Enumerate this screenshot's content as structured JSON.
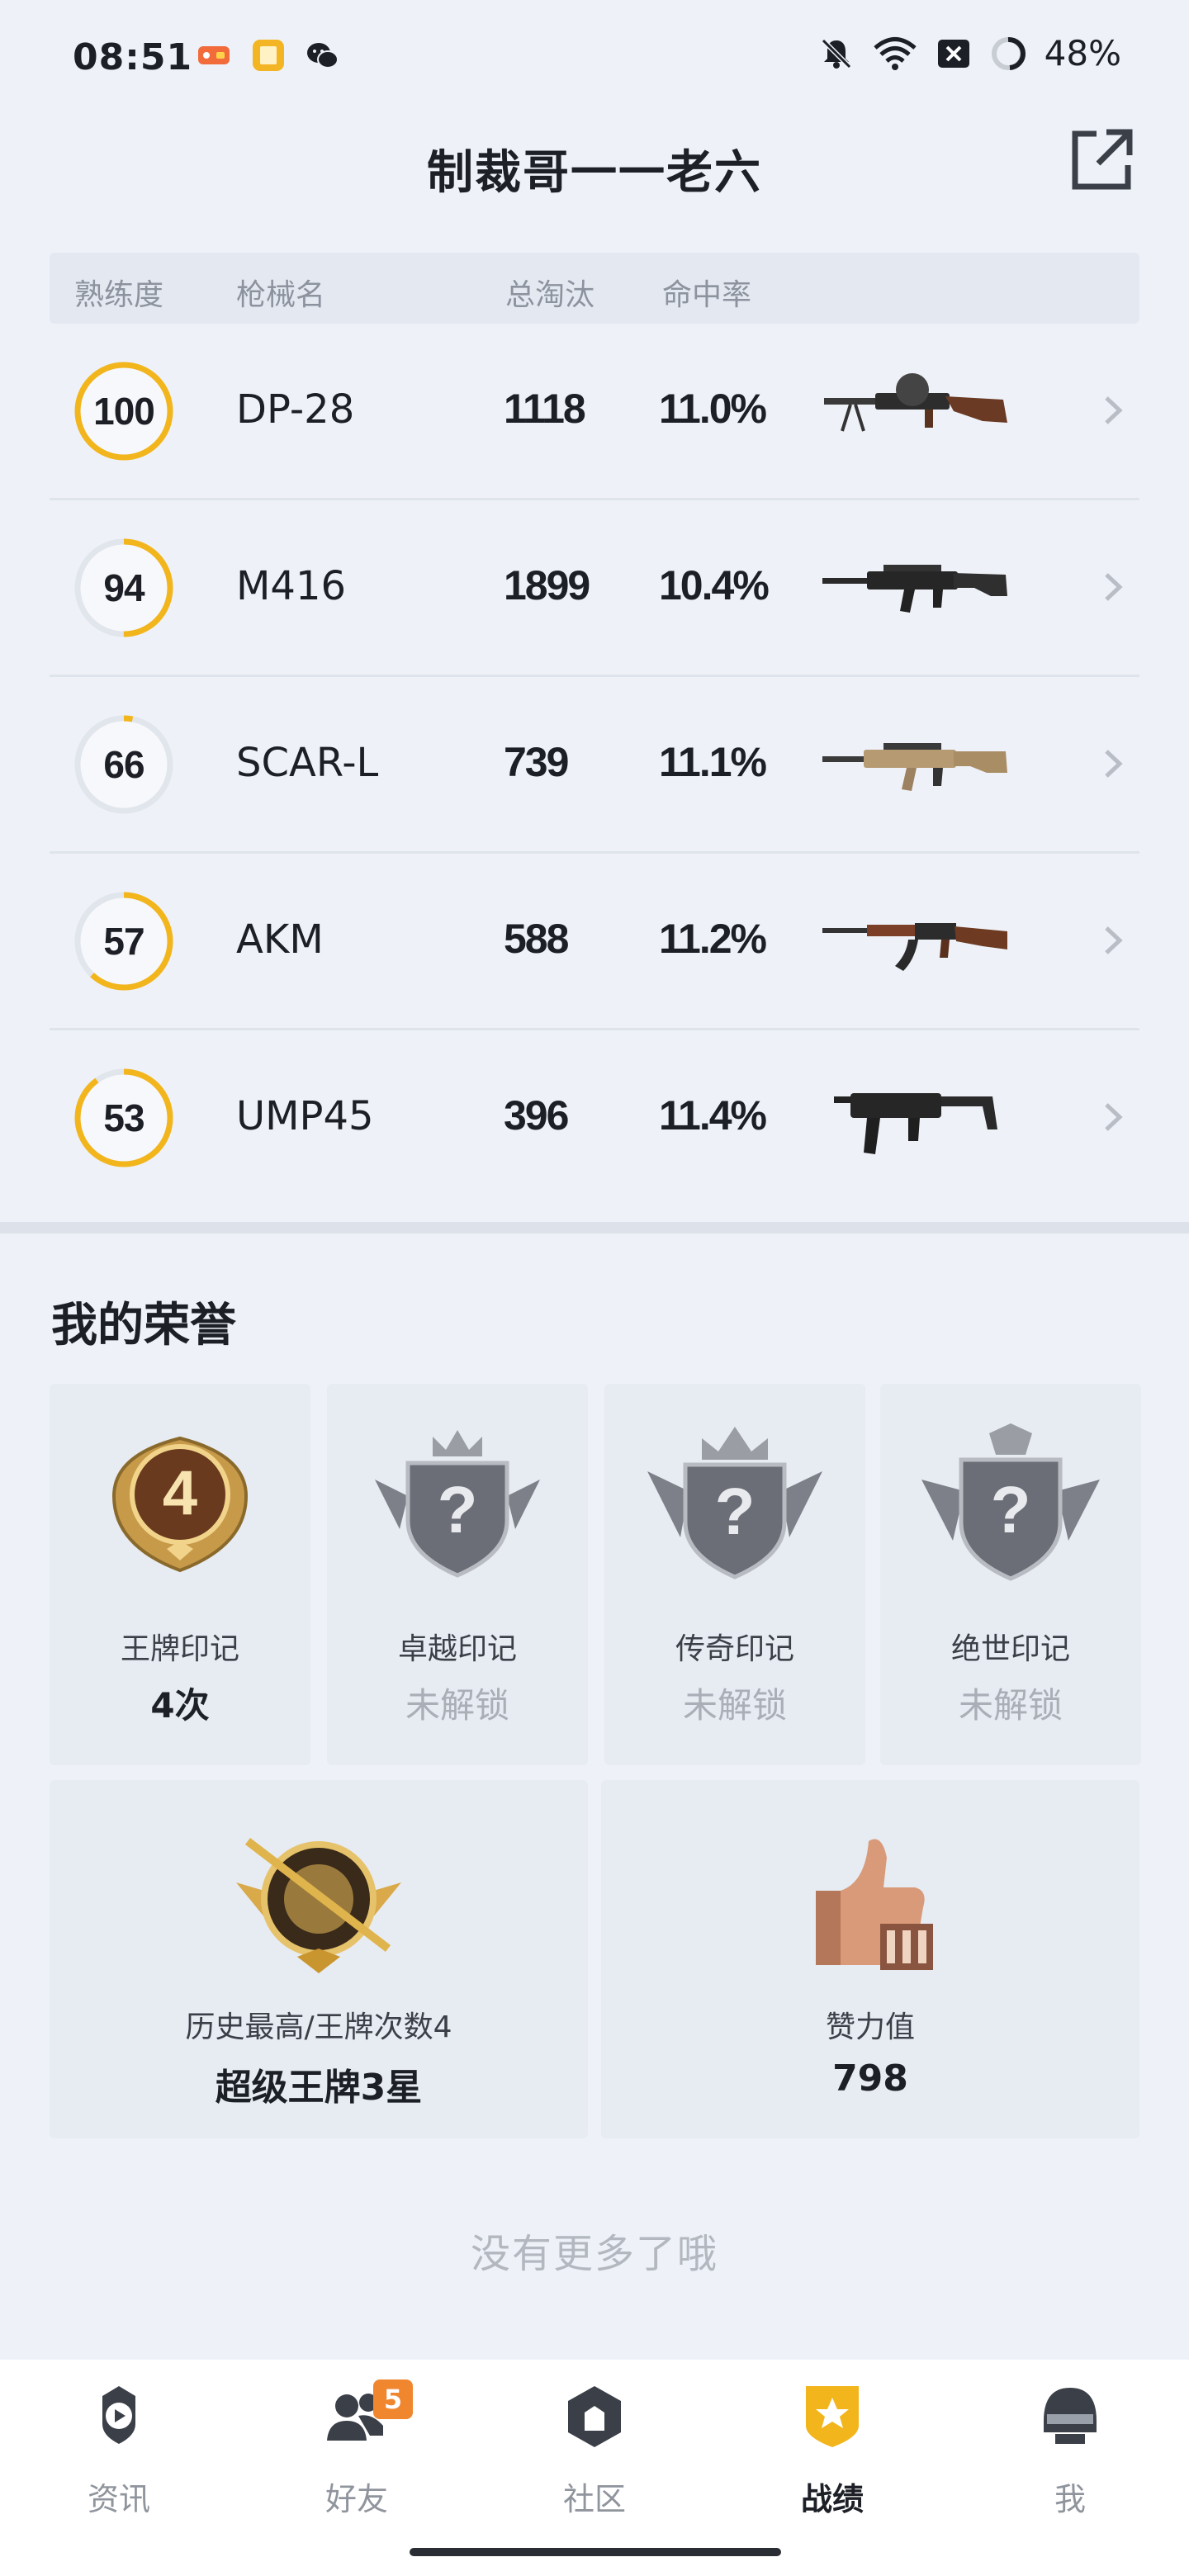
{
  "status_bar": {
    "time": "08:51",
    "battery": "48%",
    "icons": [
      "game-notification-icon",
      "reader-notification-icon",
      "wechat-notification-icon",
      "mute-bell-icon",
      "wifi-icon",
      "close-box-icon",
      "battery-ring-icon"
    ]
  },
  "header": {
    "title": "制裁哥一一老六",
    "share_icon": "share-external-icon"
  },
  "weapons_table": {
    "columns": [
      "熟练度",
      "枪械名",
      "总淘汰",
      "命中率"
    ],
    "rows": [
      {
        "proficiency": "100",
        "proficiency_fraction": 1.0,
        "name": "DP-28",
        "kills": "1118",
        "hit_rate": "11.0%",
        "image": "dp28-gun"
      },
      {
        "proficiency": "94",
        "proficiency_fraction": 0.5,
        "name": "M416",
        "kills": "1899",
        "hit_rate": "10.4%",
        "image": "m416-gun"
      },
      {
        "proficiency": "66",
        "proficiency_fraction": 0.03,
        "name": "SCAR-L",
        "kills": "739",
        "hit_rate": "11.1%",
        "image": "scarl-gun"
      },
      {
        "proficiency": "57",
        "proficiency_fraction": 0.62,
        "name": "AKM",
        "kills": "588",
        "hit_rate": "11.2%",
        "image": "akm-gun"
      },
      {
        "proficiency": "53",
        "proficiency_fraction": 0.9,
        "name": "UMP45",
        "kills": "396",
        "hit_rate": "11.4%",
        "image": "ump45-gun"
      }
    ]
  },
  "honors": {
    "title": "我的荣誉",
    "badges": [
      {
        "name": "王牌印记",
        "value": "4次",
        "locked": false,
        "emblem_number": "4"
      },
      {
        "name": "卓越印记",
        "value": "未解锁",
        "locked": true
      },
      {
        "name": "传奇印记",
        "value": "未解锁",
        "locked": true
      },
      {
        "name": "绝世印记",
        "value": "未解锁",
        "locked": true
      }
    ],
    "history": {
      "name": "历史最高/王牌次数4",
      "value": "超级王牌3星"
    },
    "likes": {
      "name": "赞力值",
      "value": "798"
    }
  },
  "footer_note": "没有更多了哦",
  "bottom_nav": {
    "items": [
      {
        "label": "资讯",
        "icon": "news-play-icon",
        "active": false
      },
      {
        "label": "好友",
        "icon": "friends-icon",
        "active": false,
        "badge": "5"
      },
      {
        "label": "社区",
        "icon": "community-icon",
        "active": false
      },
      {
        "label": "战绩",
        "icon": "record-badge-icon",
        "active": true
      },
      {
        "label": "我",
        "icon": "helmet-icon",
        "active": false
      }
    ]
  },
  "colors": {
    "accent": "#f2b51c",
    "ring_track": "#e1e5ec",
    "nav_badge": "#f0862e"
  }
}
